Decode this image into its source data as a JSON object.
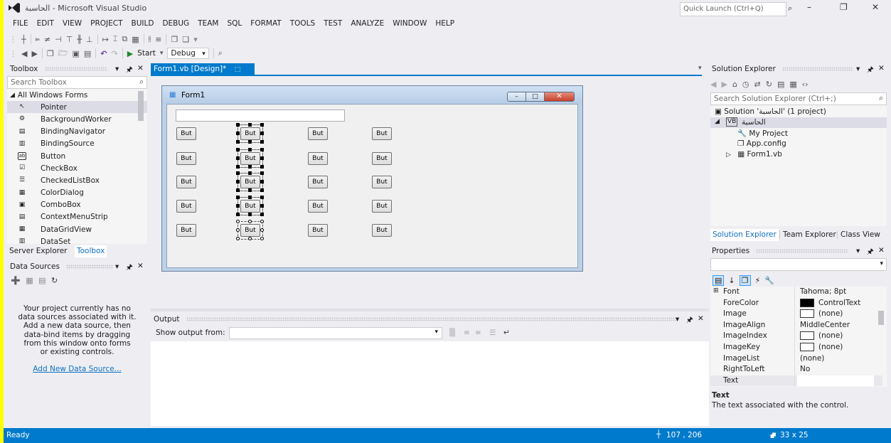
{
  "window": {
    "title": "الحاسبة - Microsoft Visual Studio",
    "quick_launch_placeholder": "Quick Launch (Ctrl+Q)"
  },
  "menu": [
    "FILE",
    "EDIT",
    "VIEW",
    "PROJECT",
    "BUILD",
    "DEBUG",
    "TEAM",
    "SQL",
    "FORMAT",
    "TOOLS",
    "TEST",
    "ANALYZE",
    "WINDOW",
    "HELP"
  ],
  "toolbar": {
    "start_label": "Start",
    "config_value": "Debug"
  },
  "toolbox": {
    "title": "Toolbox",
    "search_placeholder": "Search Toolbox",
    "group_label": "All Windows Forms",
    "items": [
      "Pointer",
      "BackgroundWorker",
      "BindingNavigator",
      "BindingSource",
      "Button",
      "CheckBox",
      "CheckedListBox",
      "ColorDialog",
      "ComboBox",
      "ContextMenuStrip",
      "DataGridView",
      "DataSet"
    ],
    "bottom_tabs": [
      "Server Explorer",
      "Toolbox"
    ]
  },
  "data_sources": {
    "title": "Data Sources",
    "message_lines": [
      "Your project currently has no",
      "data sources associated with it.",
      "Add a new data source, then",
      "data-bind items by dragging",
      "from this window onto forms",
      "or existing controls."
    ],
    "add_link": "Add New Data Source..."
  },
  "document_tab": {
    "label": "Form1.vb [Design]*"
  },
  "form": {
    "title": "Form1",
    "button_text": "But",
    "rows": 5,
    "columns": 4
  },
  "output": {
    "title": "Output",
    "show_from_label": "Show output from:"
  },
  "solution_explorer": {
    "title": "Solution Explorer",
    "search_placeholder": "Search Solution Explorer (Ctrl+;)",
    "solution_label": "Solution 'الحاسبة' (1 project)",
    "project_label": "الحاسبة",
    "items": [
      "My Project",
      "App.config",
      "Form1.vb"
    ],
    "bottom_tabs": [
      "Solution Explorer",
      "Team Explorer",
      "Class View"
    ]
  },
  "properties": {
    "title": "Properties",
    "rows": [
      {
        "name": "Font",
        "value": "Tahoma; 8pt",
        "swatch": ""
      },
      {
        "name": "ForeColor",
        "value": "ControlText",
        "swatch": "#000000"
      },
      {
        "name": "Image",
        "value": "(none)",
        "swatch": "#ffffff"
      },
      {
        "name": "ImageAlign",
        "value": "MiddleCenter",
        "swatch": ""
      },
      {
        "name": "ImageIndex",
        "value": "(none)",
        "swatch": "#ffffff"
      },
      {
        "name": "ImageKey",
        "value": "(none)",
        "swatch": "#ffffff"
      },
      {
        "name": "ImageList",
        "value": "(none)",
        "swatch": ""
      },
      {
        "name": "RightToLeft",
        "value": "No",
        "swatch": ""
      },
      {
        "name": "Text",
        "value": "",
        "swatch": ""
      }
    ],
    "desc_title": "Text",
    "desc_text": "The text associated with the control."
  },
  "status": {
    "text": "Ready",
    "position": "107 , 206",
    "size": "33 x 25"
  },
  "colors": {
    "accent": "#007acc",
    "yellow_border": "#ffff00"
  }
}
